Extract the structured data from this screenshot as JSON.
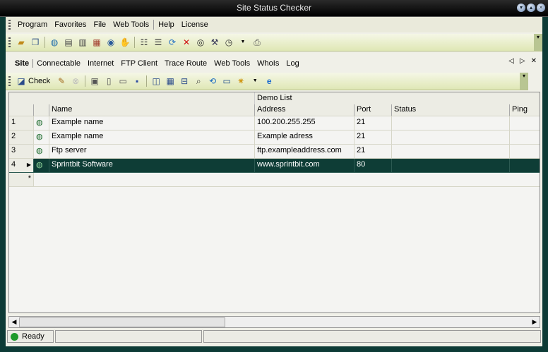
{
  "window": {
    "title": "Site Status Checker"
  },
  "menu": [
    "Program",
    "Favorites",
    "File",
    "Web Tools",
    "Help",
    "License"
  ],
  "toolbar1_icons": [
    "open-folder-icon",
    "copy-icon",
    "globe-icon",
    "host-icon",
    "ip-icon",
    "network-icon",
    "web-icon",
    "hand-icon",
    "list-icon",
    "details-icon",
    "refresh-icon",
    "delete-icon",
    "binoculars-icon",
    "tools-icon",
    "clock-icon",
    "print-icon"
  ],
  "tabs": [
    "Site",
    "Connectable",
    "Internet",
    "FTP Client",
    "Trace Route",
    "Web Tools",
    "WhoIs",
    "Log"
  ],
  "toolbar2": {
    "check_label": "Check"
  },
  "grid": {
    "group_title": "Demo List",
    "columns": {
      "name": "Name",
      "address": "Address",
      "port": "Port",
      "status": "Status",
      "ping": "Ping"
    },
    "rows": [
      {
        "num": "1",
        "name": "Example name",
        "address": "100.200.255.255",
        "port": "21",
        "status": "",
        "ping": ""
      },
      {
        "num": "2",
        "name": "Example name",
        "address": "Example adress",
        "port": "21",
        "status": "",
        "ping": ""
      },
      {
        "num": "3",
        "name": "Ftp server",
        "address": "ftp.exampleaddress.com",
        "port": "21",
        "status": "",
        "ping": ""
      },
      {
        "num": "4",
        "name": "Sprintbit Software",
        "address": "www.sprintbit.com",
        "port": "80",
        "status": "",
        "ping": ""
      }
    ],
    "new_row_marker": "*",
    "selected_row": 4
  },
  "status": {
    "text": "Ready",
    "color": "#1e9a2c"
  }
}
